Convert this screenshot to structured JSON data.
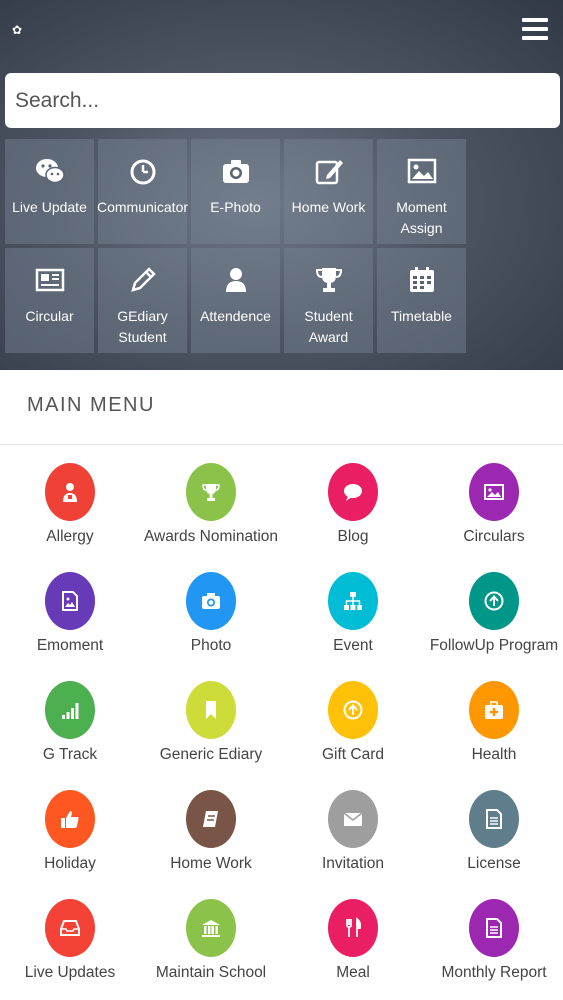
{
  "header": {
    "search_placeholder": "Search...",
    "quick_tiles": [
      {
        "label": "Live Update",
        "icon": "chat-bubbles-icon"
      },
      {
        "label": "Communicator",
        "icon": "clock-icon"
      },
      {
        "label": "E-Photo",
        "icon": "camera-icon"
      },
      {
        "label": "Home Work",
        "icon": "edit-icon"
      },
      {
        "label": "Moment Assign",
        "icon": "image-icon"
      },
      {
        "label": "Circular",
        "icon": "newspaper-icon"
      },
      {
        "label": "GEdiary Student",
        "icon": "pencil-icon"
      },
      {
        "label": "Attendence",
        "icon": "user-icon"
      },
      {
        "label": "Student Award",
        "icon": "trophy-icon"
      },
      {
        "label": "Timetable",
        "icon": "calendar-icon"
      }
    ]
  },
  "main_menu": {
    "title": "MAIN MENU",
    "items": [
      {
        "label": "Allergy",
        "icon": "doctor-icon",
        "color": "#ef4136"
      },
      {
        "label": "Awards Nomination",
        "icon": "trophy-icon",
        "color": "#8bc34a"
      },
      {
        "label": "Blog",
        "icon": "speech-bubble-icon",
        "color": "#e91e63"
      },
      {
        "label": "Circulars",
        "icon": "image-icon",
        "color": "#9c27b0"
      },
      {
        "label": "Emoment",
        "icon": "image-file-icon",
        "color": "#673ab7"
      },
      {
        "label": "Photo",
        "icon": "camera-icon",
        "color": "#2196f3"
      },
      {
        "label": "Event",
        "icon": "sitemap-icon",
        "color": "#00bcd4"
      },
      {
        "label": "FollowUp Program",
        "icon": "arrow-up-circle-icon",
        "color": "#009688"
      },
      {
        "label": "G Track",
        "icon": "signal-bars-icon",
        "color": "#4caf50"
      },
      {
        "label": "Generic Ediary",
        "icon": "bookmark-icon",
        "color": "#cddc39"
      },
      {
        "label": "Gift Card",
        "icon": "arrow-up-circle-icon",
        "color": "#ffc107"
      },
      {
        "label": "Health",
        "icon": "medical-kit-icon",
        "color": "#ff9800"
      },
      {
        "label": "Holiday",
        "icon": "thumbs-up-icon",
        "color": "#ff5722"
      },
      {
        "label": "Home Work",
        "icon": "notebook-icon",
        "color": "#795548"
      },
      {
        "label": "Invitation",
        "icon": "envelope-icon",
        "color": "#9e9e9e"
      },
      {
        "label": "License",
        "icon": "document-icon",
        "color": "#607d8b"
      },
      {
        "label": "Live Updates",
        "icon": "inbox-icon",
        "color": "#f44336"
      },
      {
        "label": "Maintain School",
        "icon": "bank-icon",
        "color": "#8bc34a"
      },
      {
        "label": "Meal",
        "icon": "cutlery-icon",
        "color": "#e91e63"
      },
      {
        "label": "Monthly Report",
        "icon": "document-icon",
        "color": "#9c27b0"
      }
    ]
  }
}
